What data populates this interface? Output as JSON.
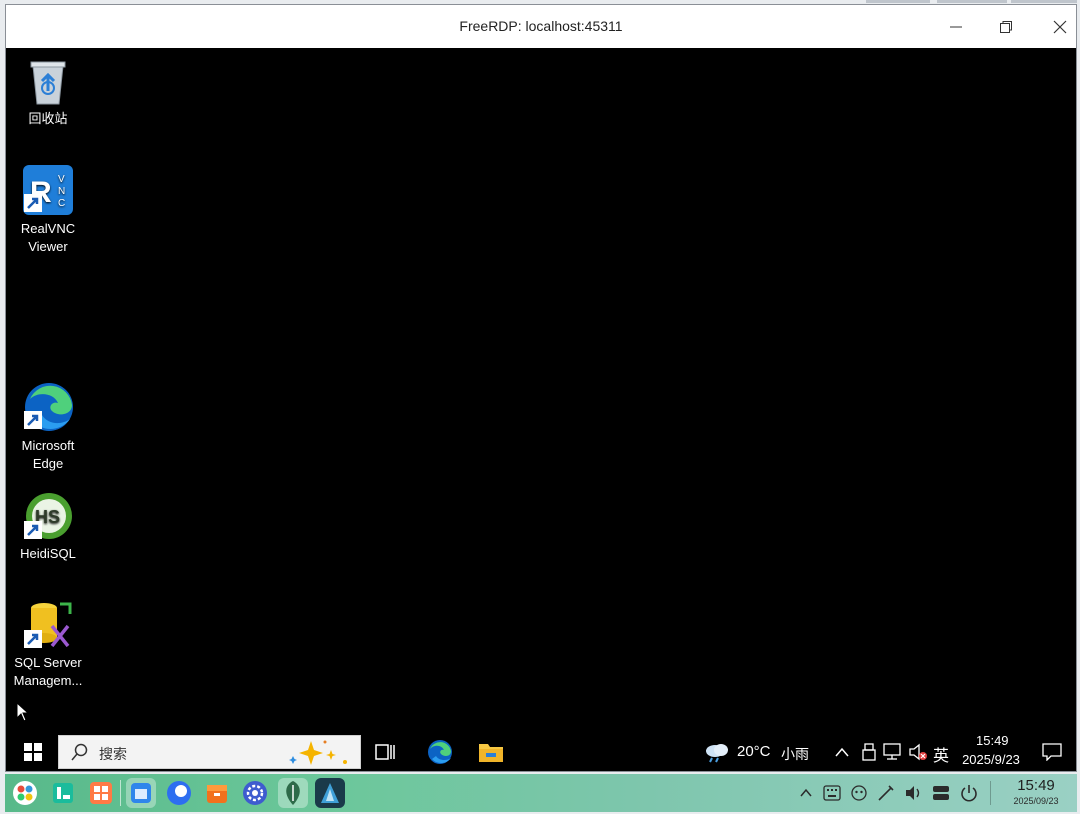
{
  "window": {
    "title": "FreeRDP: localhost:45311"
  },
  "desktop_icons": [
    {
      "label": "回收站"
    },
    {
      "label": "RealVNC\nViewer"
    },
    {
      "label": "Microsoft\nEdge"
    },
    {
      "label": "HeidiSQL"
    },
    {
      "label": "SQL Server\nManagem..."
    }
  ],
  "win_taskbar": {
    "search_label": "搜索",
    "weather_temp": "20°C",
    "weather_desc": "小雨",
    "ime": "英",
    "time": "15:49",
    "date": "2025/9/23"
  },
  "host_bar": {
    "time": "15:49",
    "date": "2025/09/23"
  },
  "colors": {
    "host_bar_gradient_start": "#58b98a",
    "host_bar_gradient_end": "#9ad0c4",
    "edge_blue": "#0c63c4",
    "edge_green": "#4fd07c"
  }
}
